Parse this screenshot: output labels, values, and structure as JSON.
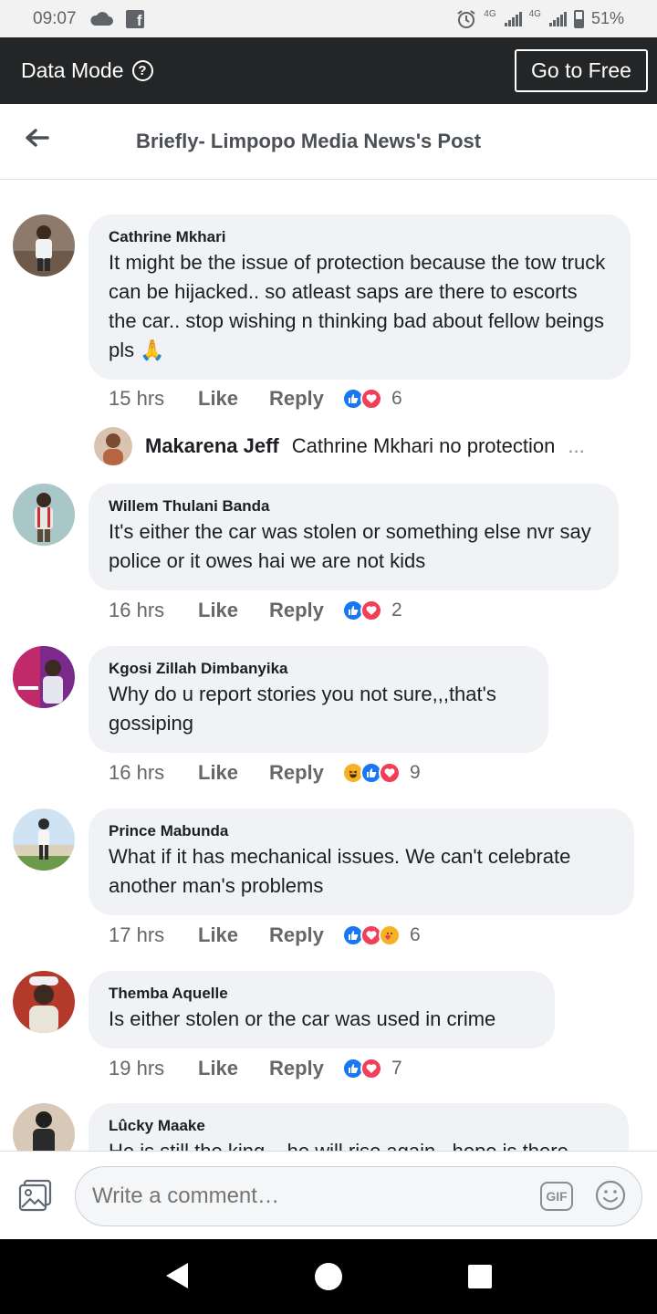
{
  "status_bar": {
    "time": "09:07",
    "net_label_1": "4G",
    "net_label_2": "4G",
    "battery": "51%"
  },
  "data_mode": {
    "title": "Data Mode",
    "help": "?",
    "go_free": "Go to Free"
  },
  "header": {
    "title": "Briefly- Limpopo Media News's Post"
  },
  "comments": [
    {
      "name": "Cathrine Mkhari",
      "text": "It might  be the issue of protection because the tow truck can be hijacked.. so atleast saps are there to escorts the car.. stop wishing n thinking bad about fellow beings pls 🙏",
      "time": "15 hrs",
      "like": "Like",
      "reply": "Reply",
      "reactions": [
        "like",
        "love"
      ],
      "count": "6"
    },
    {
      "name": "Willem Thulani Banda",
      "text": "It's either the car was stolen or something else nvr say police or it owes hai we are not kids",
      "time": "16 hrs",
      "like": "Like",
      "reply": "Reply",
      "reactions": [
        "like",
        "love"
      ],
      "count": "2"
    },
    {
      "name": "Kgosi Zillah Dimbanyika",
      "text": "Why do u report stories you not sure,,,that's gossiping",
      "time": "16 hrs",
      "like": "Like",
      "reply": "Reply",
      "reactions": [
        "haha",
        "like",
        "love"
      ],
      "count": "9"
    },
    {
      "name": "Prince Mabunda",
      "text": "What if it has mechanical issues. We can't celebrate another man's problems",
      "time": "17 hrs",
      "like": "Like",
      "reply": "Reply",
      "reactions": [
        "like",
        "love",
        "care"
      ],
      "count": "6"
    },
    {
      "name": "Themba Aquelle",
      "text": "Is either stolen or the car was used in crime",
      "time": "19 hrs",
      "like": "Like",
      "reply": "Reply",
      "reactions": [
        "like",
        "love"
      ],
      "count": "7"
    },
    {
      "name": "Lûcky Maake",
      "text": "He is still the king... he will rise again.. hope is there"
    }
  ],
  "reply_preview": {
    "name": "Makarena Jeff",
    "text": "Cathrine Mkhari no protection",
    "ellipsis": "..."
  },
  "composer": {
    "placeholder": "Write a comment…",
    "gif": "GIF"
  },
  "icons": {
    "back": "back-arrow-icon",
    "photo": "photo-icon",
    "gif": "gif-icon",
    "emoji": "emoji-icon",
    "reaction_like": "#1877f2",
    "reaction_love": "#f33e58",
    "reaction_haha": "#f7b125"
  }
}
